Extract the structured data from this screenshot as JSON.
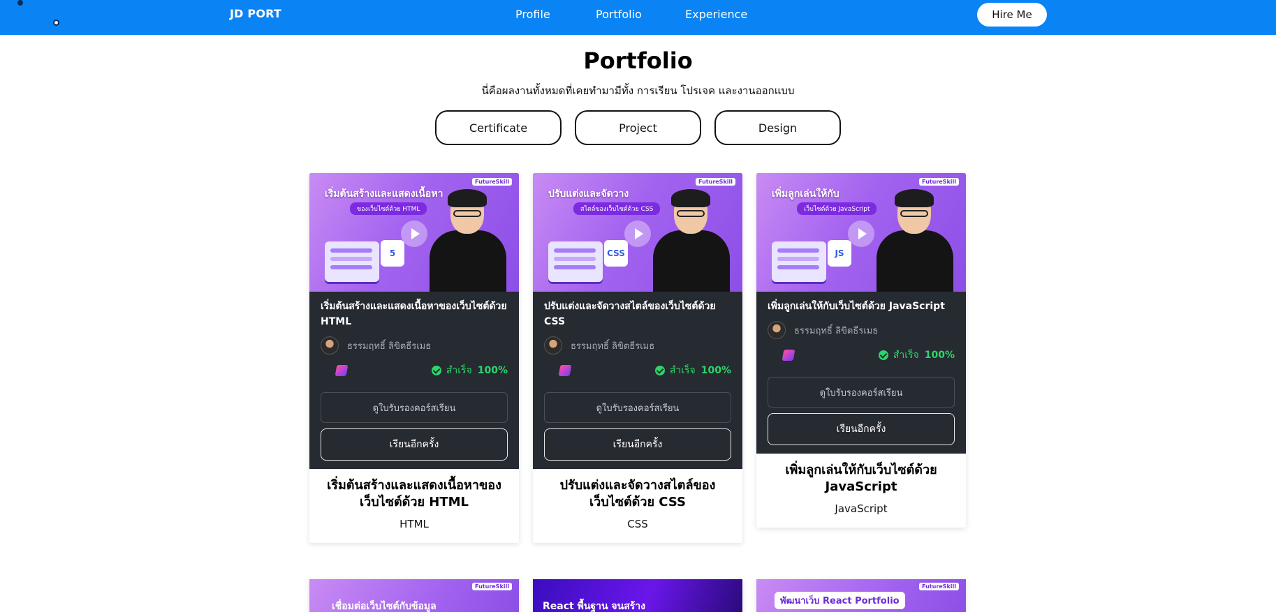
{
  "nav": {
    "brand": "JD PORT",
    "links": [
      "Profile",
      "Portfolio",
      "Experience"
    ],
    "hire": "Hire Me"
  },
  "header": {
    "title": "Portfolio",
    "subtitle": "นี่คือผลงานทั้งหมดที่เคยทำมามีทั้ง การเรียน โปรเจค และงานออกแบบ"
  },
  "filters": [
    "Certificate",
    "Project",
    "Design"
  ],
  "cards": [
    {
      "thumb_title": "เริ่มต้นสร้างและแสดงเนื้อหา",
      "thumb_tag": "ของเว็บไซต์ด้วย HTML",
      "thumb_badge": "5",
      "course_name": "เริ่มต้นสร้างและแสดงเนื้อหาของเว็บไซต์ด้วย HTML",
      "author": "ธรรมฤทธิ์ ลิขิตธีรเมธ",
      "status": "สำเร็จ",
      "percent": "100%",
      "btn_cert": "ดูใบรับรองคอร์สเรียน",
      "btn_again": "เรียนอีกครั้ง",
      "title": "เริ่มต้นสร้างและแสดงเนื้อหาของเว็บไซต์ด้วย HTML",
      "tag": "HTML"
    },
    {
      "thumb_title": "ปรับแต่งและจัดวาง",
      "thumb_tag": "สไตล์ของเว็บไซต์ด้วย CSS",
      "thumb_badge": "CSS",
      "course_name": "ปรับแต่งและจัดวางสไตล์ของเว็บไซต์ด้วย CSS",
      "author": "ธรรมฤทธิ์ ลิขิตธีรเมธ",
      "status": "สำเร็จ",
      "percent": "100%",
      "btn_cert": "ดูใบรับรองคอร์สเรียน",
      "btn_again": "เรียนอีกครั้ง",
      "title": "ปรับแต่งและจัดวางสไตล์ของเว็บไซต์ด้วย CSS",
      "tag": "CSS"
    },
    {
      "thumb_title": "เพิ่มลูกเล่นให้กับ",
      "thumb_tag": "เว็บไซต์ด้วย JavaScript",
      "thumb_badge": "JS",
      "course_name": "เพิ่มลูกเล่นให้กับเว็บไซต์ด้วย JavaScript",
      "author": "ธรรมฤทธิ์ ลิขิตธีรเมธ",
      "status": "สำเร็จ",
      "percent": "100%",
      "btn_cert": "ดูใบรับรองคอร์สเรียน",
      "btn_again": "เรียนอีกครั้ง",
      "title": "เพิ่มลูกเล่นให้กับเว็บไซต์ด้วย JavaScript",
      "tag": "JavaScript"
    }
  ],
  "next_cards": [
    {
      "text": "เชื่อมต่อเว็บไซต์กับข้อมูล"
    },
    {
      "text": "React พื้นฐาน จนสร้าง"
    },
    {
      "text": "พัฒนาเว็บ React Portfolio"
    }
  ],
  "brand_label": "FutureSkill",
  "colors": {
    "navbar": "#0a84f5",
    "card_dark": "#262a31",
    "success": "#2fd46a",
    "thumb_purple": "#a363f0"
  }
}
